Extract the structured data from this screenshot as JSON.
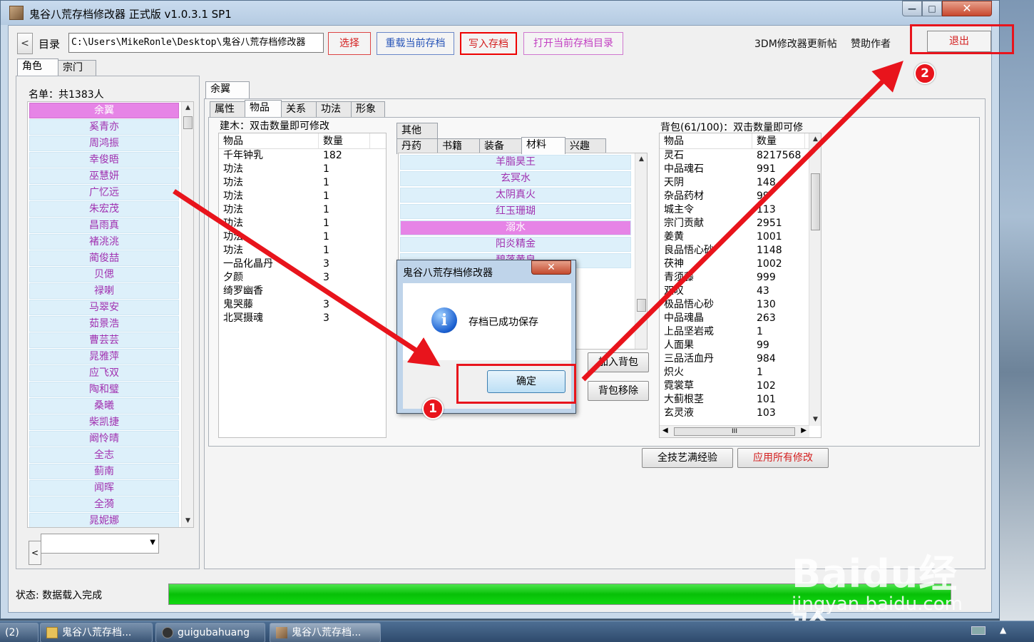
{
  "window": {
    "title": "鬼谷八荒存档修改器 正式版 v1.0.3.1 SP1",
    "controls": {
      "minimize": "—",
      "maximize": "□",
      "close": "✕"
    }
  },
  "toolbar": {
    "back": "<",
    "dir_label": "目录",
    "path": "C:\\Users\\MikeRonle\\Desktop\\鬼谷八荒存档修改器",
    "select": "选择",
    "reload": "重载当前存档",
    "write": "写入存档",
    "open_dir": "打开当前存档目录",
    "update_link": "3DM修改器更新帖",
    "sponsor": "赞助作者",
    "exit": "退出"
  },
  "top_tabs": [
    "角色",
    "宗门"
  ],
  "roster": {
    "label": "名单：共1383人",
    "names": [
      "余翼",
      "奚青亦",
      "周鸿振",
      "幸俊晤",
      "巫慧妍",
      "广忆远",
      "朱宏茂",
      "昌雨真",
      "褚洮洮",
      "蔺俊喆",
      "贝偲",
      "禄喇",
      "马翠安",
      "茹景浩",
      "曹芸芸",
      "晁雅萍",
      "应飞双",
      "陶和璧",
      "桑曦",
      "柴凯捷",
      "阚怜晴",
      "全志",
      "蓟南",
      "闻晖",
      "全漪",
      "晁妮娜"
    ],
    "selected": "余翼"
  },
  "character_tab": "余翼",
  "sub_tabs": [
    "属性",
    "物品",
    "关系",
    "功法",
    "形象"
  ],
  "building": {
    "label": "建木：双击数量即可修改",
    "headers": [
      "物品",
      "数量"
    ],
    "rows": [
      [
        "千年钟乳",
        "182"
      ],
      [
        "功法",
        "1"
      ],
      [
        "功法",
        "1"
      ],
      [
        "功法",
        "1"
      ],
      [
        "功法",
        "1"
      ],
      [
        "功法",
        "1"
      ],
      [
        "功法",
        "1"
      ],
      [
        "功法",
        "1"
      ],
      [
        "一品化晶丹",
        "3"
      ],
      [
        "夕颜",
        "3"
      ],
      [
        "绮罗幽香",
        ""
      ],
      [
        "鬼哭藤",
        "3"
      ],
      [
        "北冥摄魂",
        "3"
      ]
    ]
  },
  "category_tabs_top": [
    "其他"
  ],
  "category_tabs": [
    "丹药",
    "书籍",
    "装备",
    "材料",
    "兴趣"
  ],
  "materials": {
    "items": [
      "羊脂昊王",
      "玄冥水",
      "太阴真火",
      "红玉珊瑚",
      "溺水",
      "阳炎精金",
      "碧落黄泉"
    ],
    "selected": "溺水"
  },
  "actions": {
    "add_to_bag": "加入背包",
    "remove_from_bag": "背包移除",
    "max_skills": "全技艺满经验",
    "apply_all": "应用所有修改"
  },
  "bag": {
    "label": "背包(61/100)：双击数量即可修",
    "headers": [
      "物品",
      "数量"
    ],
    "rows": [
      [
        "灵石",
        "8217568"
      ],
      [
        "中品魂石",
        "991"
      ],
      [
        "天阴",
        "148"
      ],
      [
        "杂品药材",
        "99"
      ],
      [
        "城主令",
        "113"
      ],
      [
        "宗门贡献",
        "2951"
      ],
      [
        "姜黄",
        "1001"
      ],
      [
        "良品悟心砂",
        "1148"
      ],
      [
        "茯神",
        "1002"
      ],
      [
        "青须藤",
        "999"
      ],
      [
        "双叹",
        "43"
      ],
      [
        "极品悟心砂",
        "130"
      ],
      [
        "中品魂晶",
        "263"
      ],
      [
        "上品坚岩戒",
        "1"
      ],
      [
        "人面果",
        "99"
      ],
      [
        "三品活血丹",
        "984"
      ],
      [
        "炽火",
        "1"
      ],
      [
        "霓裳草",
        "102"
      ],
      [
        "大蓟根茎",
        "101"
      ],
      [
        "玄灵液",
        "103"
      ]
    ],
    "hscroll": "III"
  },
  "status": {
    "text": "状态: 数据载入完成",
    "progress": 1.0
  },
  "dialog": {
    "title": "鬼谷八荒存档修改器",
    "close": "✕",
    "message": "存档已成功保存",
    "ok": "确定",
    "icon": "info-icon"
  },
  "annotations": {
    "badge1": "1",
    "badge2": "2",
    "color": "#e8141c"
  },
  "watermark": {
    "logo": "Baidu经验",
    "url": "jingyan.baidu.com"
  },
  "taskbar": {
    "items": [
      "(2)",
      "鬼谷八荒存档...",
      "guigubahuang",
      "鬼谷八荒存档..."
    ]
  }
}
